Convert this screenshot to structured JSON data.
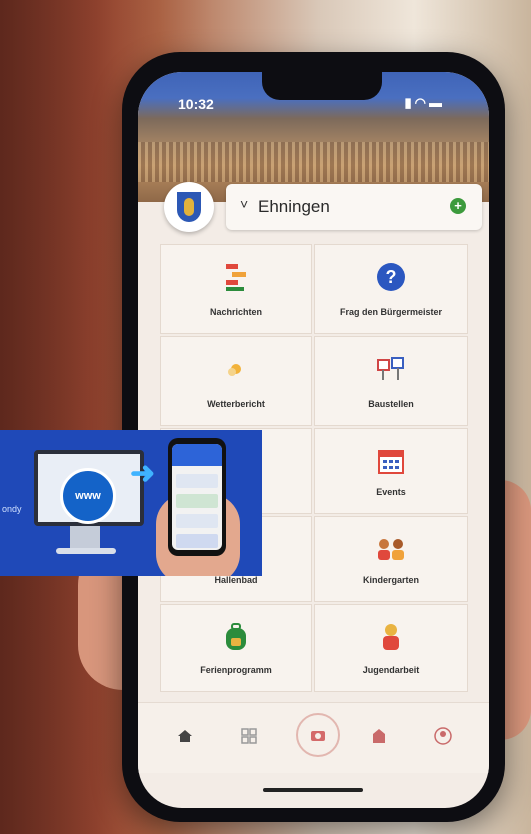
{
  "phone": {
    "time": "10:32",
    "status_icons": [
      "signal-icon",
      "wifi-icon",
      "battery-icon"
    ]
  },
  "header": {
    "town": "Ehningen",
    "chevron": "˅",
    "add": "+"
  },
  "tiles": [
    {
      "label": "Nachrichten",
      "icon": "news-icon"
    },
    {
      "label": "Frag den Bürgermeister",
      "icon": "question-icon"
    },
    {
      "label": "Wetterbericht",
      "icon": "weather-icon"
    },
    {
      "label": "Baustellen",
      "icon": "construction-icon"
    },
    {
      "label": "",
      "icon": "hidden-icon"
    },
    {
      "label": "Events",
      "icon": "calendar-icon"
    },
    {
      "label": "Hallenbad",
      "icon": "pool-icon"
    },
    {
      "label": "Kindergarten",
      "icon": "kids-icon"
    },
    {
      "label": "Ferienprogramm",
      "icon": "backpack-icon"
    },
    {
      "label": "Jugendarbeit",
      "icon": "youth-icon"
    }
  ],
  "navbar": [
    "home-icon",
    "grid-icon",
    "camera-icon",
    "town-hall-icon",
    "profile-icon"
  ],
  "overlay": {
    "www_label": "www",
    "caption": "ondy"
  }
}
